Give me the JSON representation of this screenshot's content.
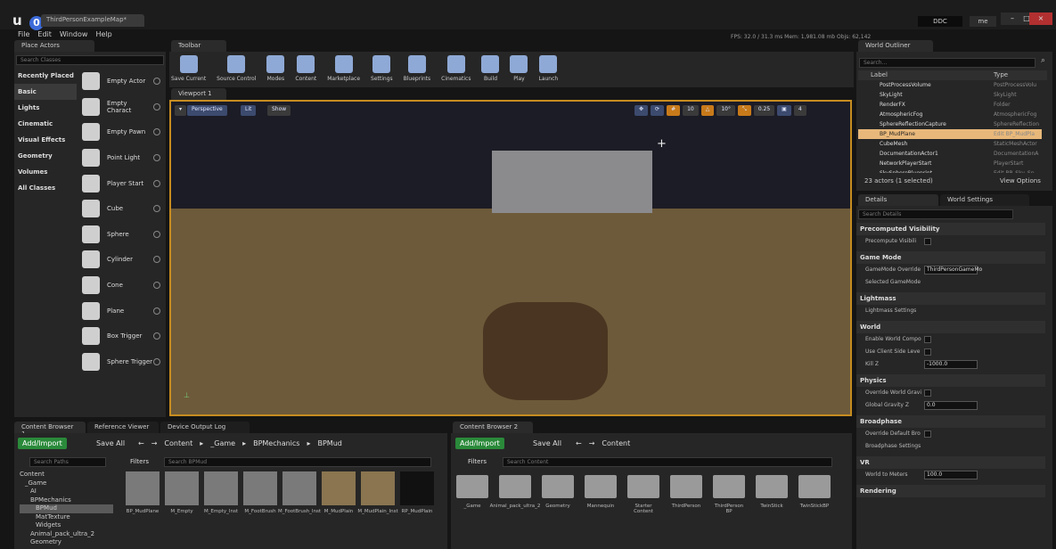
{
  "window": {
    "project_tab": "ThirdPersonExampleMap*",
    "logo": "u",
    "badge": "0",
    "ddc": "DDC",
    "user": "me"
  },
  "menu": [
    "File",
    "Edit",
    "Window",
    "Help"
  ],
  "stats": "FPS: 32.0 / 31.3 ms  Mem: 1,981.08 mb  Objs: 62,142",
  "place_actors": {
    "tab": "Place Actors",
    "search": "Search Classes",
    "categories": [
      "Recently Placed",
      "Basic",
      "Lights",
      "Cinematic",
      "Visual Effects",
      "Geometry",
      "Volumes",
      "All Classes"
    ],
    "selected_category": "Basic",
    "actors": [
      "Empty Actor",
      "Empty Charact",
      "Empty Pawn",
      "Point Light",
      "Player Start",
      "Cube",
      "Sphere",
      "Cylinder",
      "Cone",
      "Plane",
      "Box Trigger",
      "Sphere Trigger"
    ]
  },
  "toolbar": {
    "tab": "Toolbar",
    "buttons": [
      "Save Current",
      "Source Control",
      "Modes",
      "Content",
      "Marketplace",
      "Settings",
      "Blueprints",
      "Cinematics",
      "Build",
      "Play",
      "Launch"
    ]
  },
  "viewport": {
    "tab": "Viewport 1",
    "perspective": "Perspective",
    "lit": "Lit",
    "show": "Show",
    "grid": "10",
    "angle": "10°",
    "scale": "0.25",
    "cam_speed": "4"
  },
  "outliner": {
    "tab": "World Outliner",
    "search": "Search...",
    "col_label": "Label",
    "col_type": "Type",
    "rows": [
      {
        "label": "PostProcessVolume",
        "type": "PostProcessVolu"
      },
      {
        "label": "SkyLight",
        "type": "SkyLight"
      },
      {
        "label": "RenderFX",
        "type": "Folder"
      },
      {
        "label": "AtmosphericFog",
        "type": "AtmosphericFog"
      },
      {
        "label": "SphereReflectionCapture",
        "type": "SphereReflection"
      },
      {
        "label": "BP_MudPlane",
        "type": "Edit BP_MudPla"
      },
      {
        "label": "CubeMesh",
        "type": "StaticMeshActor"
      },
      {
        "label": "DocumentationActor1",
        "type": "DocumentationA"
      },
      {
        "label": "NetworkPlayerStart",
        "type": "PlayerStart"
      },
      {
        "label": "SkySphereBlueprint",
        "type": "Edit BP_Sky_Sp"
      }
    ],
    "status": "23 actors (1 selected)",
    "view_options": "View Options"
  },
  "details": {
    "tab_details": "Details",
    "tab_world": "World Settings",
    "search": "Search Details",
    "sections": [
      {
        "title": "Precomputed Visibility",
        "rows": [
          {
            "label": "Precompute Visibili",
            "checkbox": true
          }
        ]
      },
      {
        "title": "Game Mode",
        "rows": [
          {
            "label": "GameMode Override",
            "value": "ThirdPersonGameMo"
          },
          {
            "label": "Selected GameMode"
          }
        ]
      },
      {
        "title": "Lightmass",
        "rows": [
          {
            "label": "Lightmass Settings"
          }
        ]
      },
      {
        "title": "World",
        "rows": [
          {
            "label": "Enable World Compo",
            "checkbox": true
          },
          {
            "label": "Use Client Side Leve",
            "checkbox": true
          },
          {
            "label": "Kill Z",
            "value": "-1000.0"
          }
        ]
      },
      {
        "title": "Physics",
        "rows": [
          {
            "label": "Override World Gravi",
            "checkbox": true
          },
          {
            "label": "Global Gravity Z",
            "value": "0.0"
          }
        ]
      },
      {
        "title": "Broadphase",
        "rows": [
          {
            "label": "Override Default Bro",
            "checkbox": true
          },
          {
            "label": "Broadphase Settings"
          }
        ]
      },
      {
        "title": "VR",
        "rows": [
          {
            "label": "World to Meters",
            "value": "100.0"
          }
        ]
      },
      {
        "title": "Rendering",
        "rows": []
      }
    ]
  },
  "content_browser_1": {
    "tabs": [
      "Content Browser 1",
      "Reference Viewer",
      "Device Output Log"
    ],
    "add_import": "Add/Import",
    "save_all": "Save All",
    "path": [
      "Content",
      "_Game",
      "BPMechanics",
      "BPMud"
    ],
    "filters": "Filters",
    "search": "Search BPMud",
    "search_paths": "Search Paths",
    "tree": [
      "Content",
      "_Game",
      "AI",
      "BPMechanics",
      "BPMud",
      "MatTexture",
      "Widgets",
      "Animal_pack_ultra_2",
      "Geometry"
    ],
    "assets": [
      "BP_MudPlane",
      "M_Empty",
      "M_Empty_Inst",
      "M_FootBrush",
      "M_FootBrush_Inst",
      "M_MudPlain",
      "M_MudPlain_Inst",
      "RP_MudPlain"
    ]
  },
  "content_browser_2": {
    "tab": "Content Browser 2",
    "add_import": "Add/Import",
    "save_all": "Save All",
    "path": "Content",
    "filters": "Filters",
    "search": "Search Content",
    "folders": [
      "_Game",
      "Animal_pack_ultra_2",
      "Geometry",
      "Mannequin",
      "Starter Content",
      "ThirdPerson",
      "ThirdPerson BP",
      "TwinStick",
      "TwinStickBP"
    ]
  }
}
